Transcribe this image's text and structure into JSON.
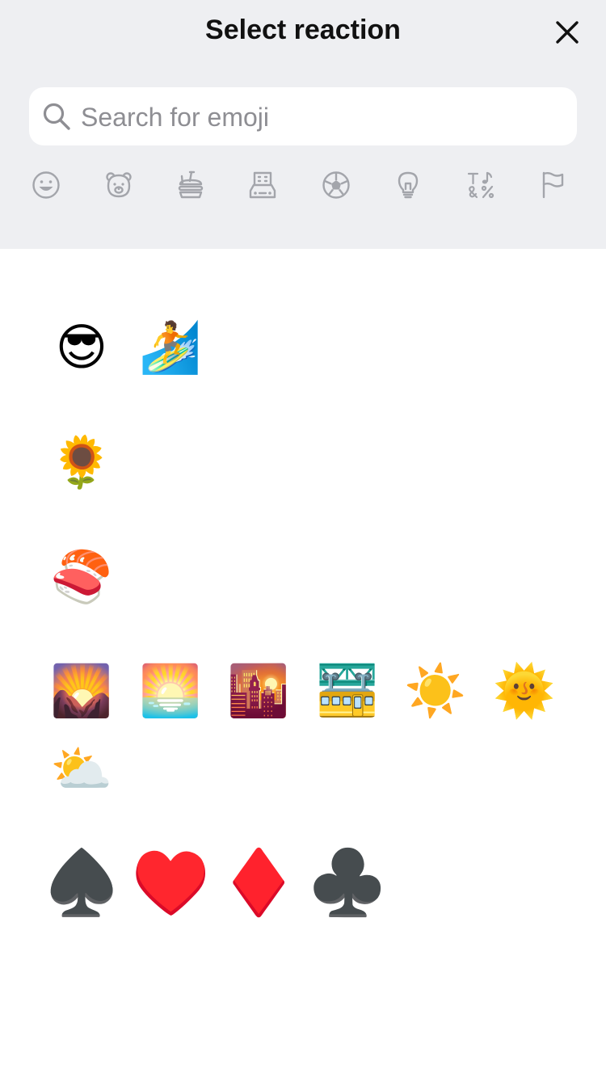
{
  "header": {
    "title": "Select reaction",
    "close_icon": "close-icon"
  },
  "search": {
    "placeholder": "Search for emoji",
    "value": "",
    "icon": "search-icon"
  },
  "categories": [
    {
      "name": "smileys",
      "icon": "smiley-icon"
    },
    {
      "name": "animals",
      "icon": "bear-icon"
    },
    {
      "name": "food",
      "icon": "food-icon"
    },
    {
      "name": "travel",
      "icon": "building-car-icon"
    },
    {
      "name": "activities",
      "icon": "soccer-ball-icon"
    },
    {
      "name": "objects",
      "icon": "lightbulb-icon"
    },
    {
      "name": "symbols",
      "icon": "symbols-icon"
    },
    {
      "name": "flags",
      "icon": "flag-icon"
    }
  ],
  "emoji_groups": [
    [
      "😎",
      "🏄"
    ],
    [
      "🌻"
    ],
    [
      "🍣"
    ],
    [
      "🌄",
      "🌅",
      "🌇",
      "🚟",
      "☀️",
      "🌞",
      "⛅"
    ],
    [
      "♠️",
      "♥️",
      "♦️",
      "♣️"
    ]
  ],
  "colors": {
    "header_bg": "#eeeff2",
    "icon_gray": "#a3a5ab",
    "spade": "#111111",
    "heart": "#d61f1f",
    "diamond": "#e5141c",
    "club": "#111111"
  }
}
